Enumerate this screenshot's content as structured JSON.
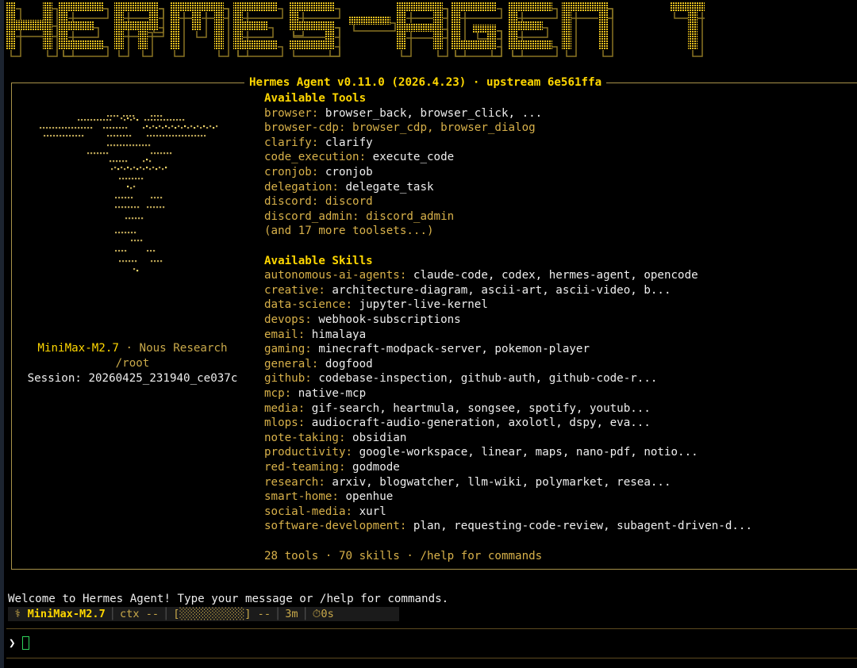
{
  "banner": {
    "text": "HERMES-AGENT"
  },
  "frame": {
    "title": "Hermes Agent v0.11.0 (2026.4.23) · upstream 6e561ffa"
  },
  "info": {
    "model": "MiniMax-M2.7",
    "provider_sep": " · ",
    "provider": "Nous Research",
    "cwd": "/root",
    "session": "Session: 20260425_231940_ce037c"
  },
  "tools": {
    "heading": "Available Tools",
    "items": [
      {
        "key": "browser:",
        "value": "browser_back, browser_click, ..."
      },
      {
        "key": "browser-cdp:",
        "value": "browser_cdp, browser_dialog",
        "dim": true
      },
      {
        "key": "clarify:",
        "value": "clarify"
      },
      {
        "key": "code_execution:",
        "value": "execute_code"
      },
      {
        "key": "cronjob:",
        "value": "cronjob"
      },
      {
        "key": "delegation:",
        "value": "delegate_task"
      },
      {
        "key": "discord:",
        "value": "discord",
        "dim": true
      },
      {
        "key": "discord_admin:",
        "value": "discord_admin",
        "dim": true
      }
    ],
    "more": "(and 17 more toolsets...)"
  },
  "skills": {
    "heading": "Available Skills",
    "items": [
      {
        "key": "autonomous-ai-agents:",
        "value": "claude-code, codex, hermes-agent, opencode"
      },
      {
        "key": "creative:",
        "value": "architecture-diagram, ascii-art, ascii-video, b..."
      },
      {
        "key": "data-science:",
        "value": "jupyter-live-kernel"
      },
      {
        "key": "devops:",
        "value": "webhook-subscriptions"
      },
      {
        "key": "email:",
        "value": "himalaya"
      },
      {
        "key": "gaming:",
        "value": "minecraft-modpack-server, pokemon-player"
      },
      {
        "key": "general:",
        "value": "dogfood"
      },
      {
        "key": "github:",
        "value": "codebase-inspection, github-auth, github-code-r..."
      },
      {
        "key": "mcp:",
        "value": "native-mcp"
      },
      {
        "key": "media:",
        "value": "gif-search, heartmula, songsee, spotify, youtub..."
      },
      {
        "key": "mlops:",
        "value": "audiocraft-audio-generation, axolotl, dspy, eva..."
      },
      {
        "key": "note-taking:",
        "value": "obsidian"
      },
      {
        "key": "productivity:",
        "value": "google-workspace, linear, maps, nano-pdf, notio..."
      },
      {
        "key": "red-teaming:",
        "value": "godmode"
      },
      {
        "key": "research:",
        "value": "arxiv, blogwatcher, llm-wiki, polymarket, resea..."
      },
      {
        "key": "smart-home:",
        "value": "openhue"
      },
      {
        "key": "social-media:",
        "value": "xurl"
      },
      {
        "key": "software-development:",
        "value": "plan, requesting-code-review, subagent-driven-d..."
      }
    ]
  },
  "summary": "28 tools · 70 skills · /help for commands",
  "welcome": "Welcome to Hermes Agent! Type your message or /help for commands.",
  "status": {
    "model": "MiniMax-M2.7",
    "ctx": "ctx --",
    "bar": "[░░░░░░░░░░] --",
    "time": "3m",
    "timer": "0s"
  },
  "prompt": {
    "symbol": "❯"
  },
  "icons": {
    "status_model": "caduceus-icon",
    "status_timer": "timer-icon"
  },
  "colors": {
    "accent": "#ffd700",
    "label": "#d8b14a",
    "frame": "#a8924a"
  }
}
